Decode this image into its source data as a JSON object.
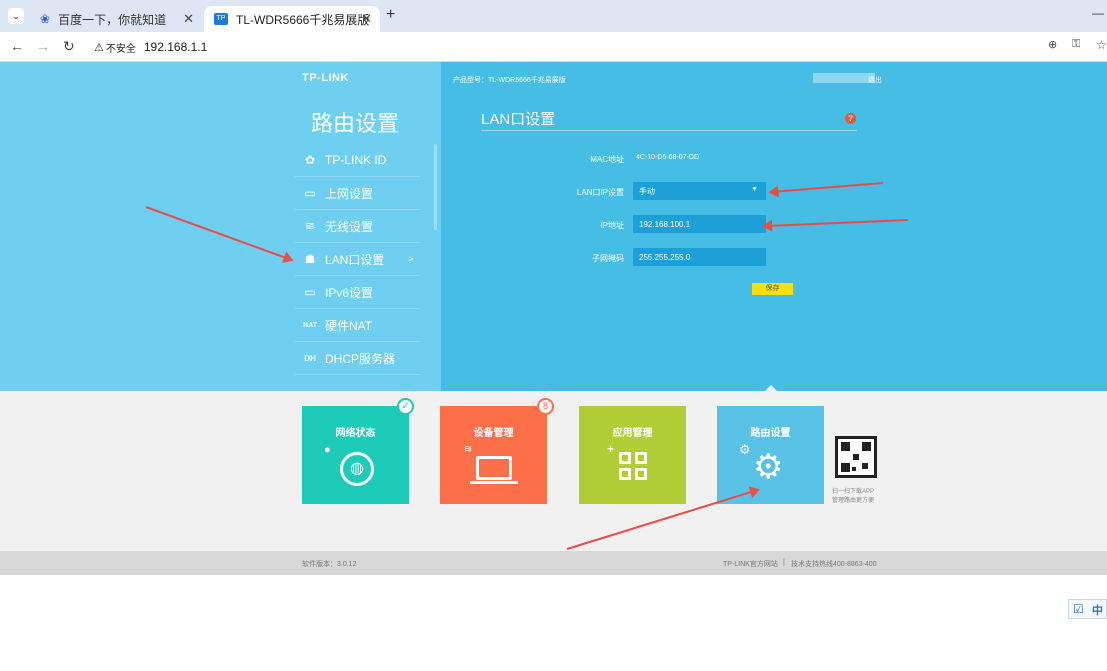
{
  "browser": {
    "tabs": [
      {
        "title": "百度一下，你就知道",
        "active": false
      },
      {
        "title": "TL-WDR5666千兆易展版",
        "active": true
      }
    ],
    "new_tab": "+",
    "minimize": "—",
    "security_label": "不安全",
    "url": "192.168.1.1"
  },
  "header": {
    "logo": "TP-LINK",
    "model": "产品型号：TL-WDR5666千兆易展版",
    "logout": "退出"
  },
  "sidebar": {
    "title": "路由设置",
    "items": [
      {
        "label": "TP-LINK ID",
        "icon": "gear-icon",
        "glyph": "✿"
      },
      {
        "label": "上网设置",
        "icon": "monitor-icon",
        "glyph": "▭"
      },
      {
        "label": "无线设置",
        "icon": "wifi-icon",
        "glyph": "≋"
      },
      {
        "label": "LAN口设置",
        "icon": "router-icon",
        "glyph": "☗",
        "active": true,
        "chevron": ">"
      },
      {
        "label": "IPv6设置",
        "icon": "monitor-icon",
        "glyph": "▭"
      },
      {
        "label": "硬件NAT",
        "icon": "nat-icon",
        "glyph": "NAT"
      },
      {
        "label": "DHCP服务器",
        "icon": "dhcp-icon",
        "glyph": "DH"
      }
    ]
  },
  "panel": {
    "title": "LAN口设置",
    "help": "?",
    "mac_label": "MAC地址",
    "mac_value": "4C-10-D5-68-07-DD",
    "lan_ip_label": "LAN口IP设置",
    "lan_ip_mode": "手动",
    "ip_label": "IP地址",
    "ip_value": "192.168.100.1",
    "mask_label": "子网掩码",
    "mask_value": "255.255.255.0",
    "save_label": "保存"
  },
  "tiles": [
    {
      "title": "网络状态",
      "color": "#1dccb8",
      "badge": "✓"
    },
    {
      "title": "设备管理",
      "color": "#fb7049",
      "badge": "8"
    },
    {
      "title": "应用管理",
      "color": "#b2cc35",
      "badge": ""
    },
    {
      "title": "路由设置",
      "color": "#58c2e6",
      "badge": ""
    }
  ],
  "qr": {
    "line1": "扫一扫下载APP",
    "line2": "管理路由更方便"
  },
  "footer": {
    "version": "软件版本：3.0.12",
    "website": "TP-LINK官方网站",
    "separator": "|",
    "hotline": "技术支持热线400-8863-400"
  },
  "tray": {
    "ime": "中"
  },
  "colors": {
    "hero_left": "#6fcff0",
    "hero_right": "#45bde4",
    "save_button": "#f5e20c",
    "annotation_arrow": "#e84d48"
  }
}
